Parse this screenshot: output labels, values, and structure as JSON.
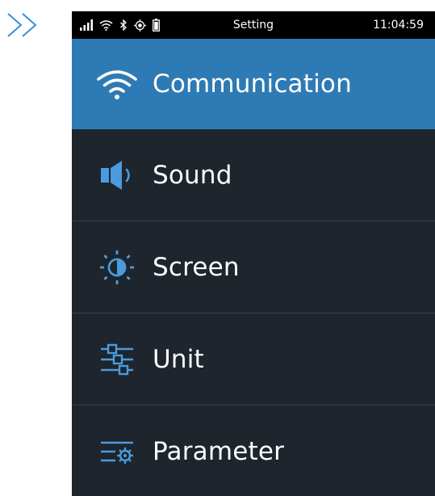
{
  "statusbar": {
    "title": "Setting",
    "time": "11:04:59",
    "icons": [
      "signal-icon",
      "wifi-icon",
      "bluetooth-icon",
      "location-icon",
      "battery-icon"
    ]
  },
  "menu": {
    "items": [
      {
        "label": "Communication",
        "icon": "wifi-icon",
        "active": true
      },
      {
        "label": "Sound",
        "icon": "speaker-icon",
        "active": false
      },
      {
        "label": "Screen",
        "icon": "brightness-icon",
        "active": false
      },
      {
        "label": "Unit",
        "icon": "sliders-icon",
        "active": false
      },
      {
        "label": "Parameter",
        "icon": "parameter-gear-icon",
        "active": false
      }
    ]
  },
  "colors": {
    "active_bg": "#2e7ab5",
    "item_bg": "#1e252c",
    "accent_icon": "#4a9be0",
    "statusbar_bg": "#000000",
    "chevron": "#3a8fd6"
  }
}
